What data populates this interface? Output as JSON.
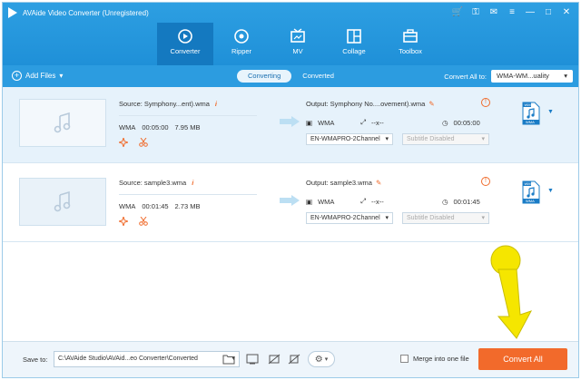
{
  "app": {
    "title": "AVAide Video Converter (Unregistered)"
  },
  "nav": [
    {
      "label": "Converter",
      "icon": "converter-icon",
      "active": true
    },
    {
      "label": "Ripper",
      "icon": "ripper-icon",
      "active": false
    },
    {
      "label": "MV",
      "icon": "mv-icon",
      "active": false
    },
    {
      "label": "Collage",
      "icon": "collage-icon",
      "active": false
    },
    {
      "label": "Toolbox",
      "icon": "toolbox-icon",
      "active": false
    }
  ],
  "toolbar": {
    "add_files_label": "Add Files",
    "tab_converting": "Converting",
    "tab_converted": "Converted",
    "convert_all_to_label": "Convert All to:",
    "format_value": "WMA-WM...uality"
  },
  "files": [
    {
      "source": "Source: Symphony...ent).wma",
      "format": "WMA",
      "duration": "00:05:00",
      "size": "7.95 MB",
      "output": "Output: Symphony No....ovement).wma",
      "out_format": "WMA",
      "out_resolution": "--x--",
      "out_duration": "00:05:00",
      "audio_track": "EN-WMAPRO-2Channel",
      "subtitle": "Subtitle Disabled"
    },
    {
      "source": "Source: sample3.wma",
      "format": "WMA",
      "duration": "00:01:45",
      "size": "2.73 MB",
      "output": "Output: sample3.wma",
      "out_format": "WMA",
      "out_resolution": "--x--",
      "out_duration": "00:01:45",
      "audio_track": "EN-WMAPRO-2Channel",
      "subtitle": "Subtitle Disabled"
    }
  ],
  "file_badge": {
    "top": "WM",
    "bottom": "WMA"
  },
  "bottom": {
    "save_to_label": "Save to:",
    "save_path": "C:\\AVAide Studio\\AVAid...eo Converter\\Converted",
    "merge_label": "Merge into one file",
    "convert_all_label": "Convert All"
  },
  "colors": {
    "accent": "#2c9ce0",
    "nav_active": "#1479c0",
    "convert_button": "#f26a2b",
    "annotation": "#f5e600"
  }
}
